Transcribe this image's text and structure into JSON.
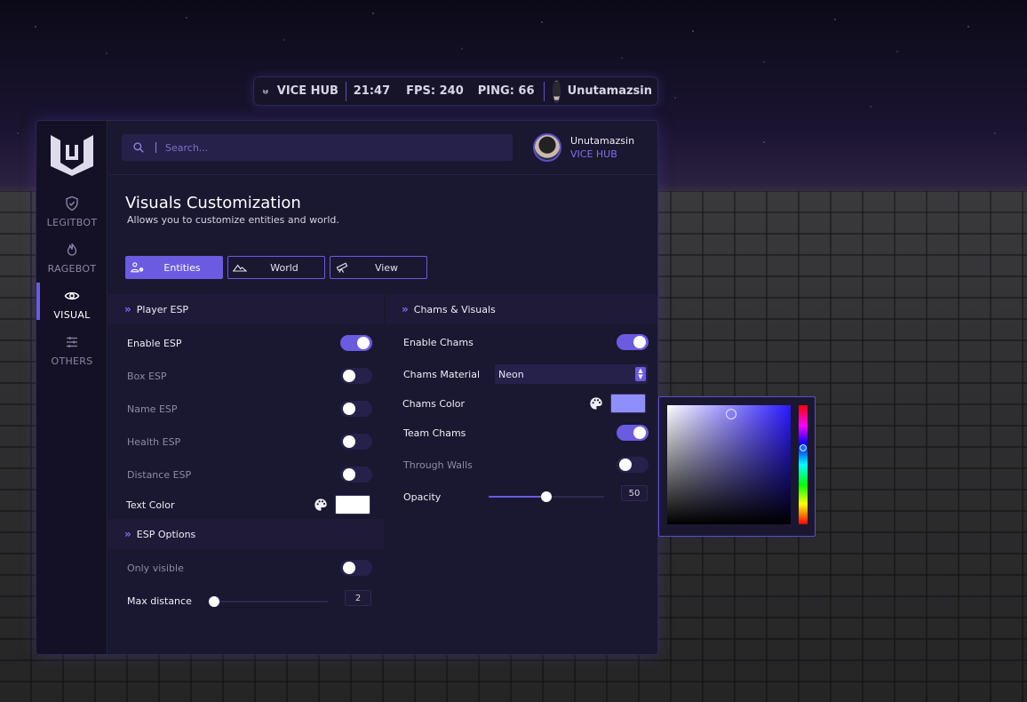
{
  "topbar": {
    "brand": "VICE HUB",
    "time": "21:47",
    "fps": "FPS: 240",
    "ping": "PING: 66",
    "username": "Unutamazsin"
  },
  "sidebar": {
    "logo_icon": "vice-hub-logo-icon",
    "items": [
      {
        "label": "LEGITBOT",
        "icon": "shield-check-icon",
        "active": false
      },
      {
        "label": "RAGEBOT",
        "icon": "flame-icon",
        "active": false
      },
      {
        "label": "VISUAL",
        "icon": "eye-icon",
        "active": true
      },
      {
        "label": "OTHERS",
        "icon": "sliders-icon",
        "active": false
      }
    ]
  },
  "header": {
    "search_placeholder": "Search...",
    "user_name": "Unutamazsin",
    "user_sub": "VICE HUB"
  },
  "page": {
    "title": "Visuals Customization",
    "subtitle": "Allows you to customize entities and world."
  },
  "tabs": [
    {
      "label": "Entities",
      "icon": "users-settings-icon",
      "active": true
    },
    {
      "label": "World",
      "icon": "mountains-icon",
      "active": false
    },
    {
      "label": "View",
      "icon": "telescope-icon",
      "active": false
    }
  ],
  "player_esp": {
    "title": "Player ESP",
    "enable_esp": {
      "label": "Enable ESP",
      "on": true
    },
    "box_esp": {
      "label": "Box ESP",
      "on": false
    },
    "name_esp": {
      "label": "Name ESP",
      "on": false
    },
    "health_esp": {
      "label": "Health ESP",
      "on": false
    },
    "distance_esp": {
      "label": "Distance ESP",
      "on": false
    },
    "text_color": {
      "label": "Text Color",
      "color": "#ffffff"
    }
  },
  "esp_options": {
    "title": "ESP Options",
    "only_visible": {
      "label": "Only visible",
      "on": false
    },
    "max_distance": {
      "label": "Max distance",
      "value": "2",
      "fraction": 0.0
    }
  },
  "chams": {
    "title": "Chams & Visuals",
    "enable_chams": {
      "label": "Enable Chams",
      "on": true
    },
    "material": {
      "label": "Chams Material",
      "value": "Neon"
    },
    "color": {
      "label": "Chams Color",
      "color": "#8f8ffb"
    },
    "team_chams": {
      "label": "Team Chams",
      "on": true
    },
    "through_walls": {
      "label": "Through Walls",
      "on": false
    },
    "opacity": {
      "label": "Opacity",
      "value": "50",
      "fraction": 0.5
    }
  },
  "colors": {
    "accent": "#6a5be0",
    "panel": "#1a1730",
    "sidebar": "#141126"
  }
}
